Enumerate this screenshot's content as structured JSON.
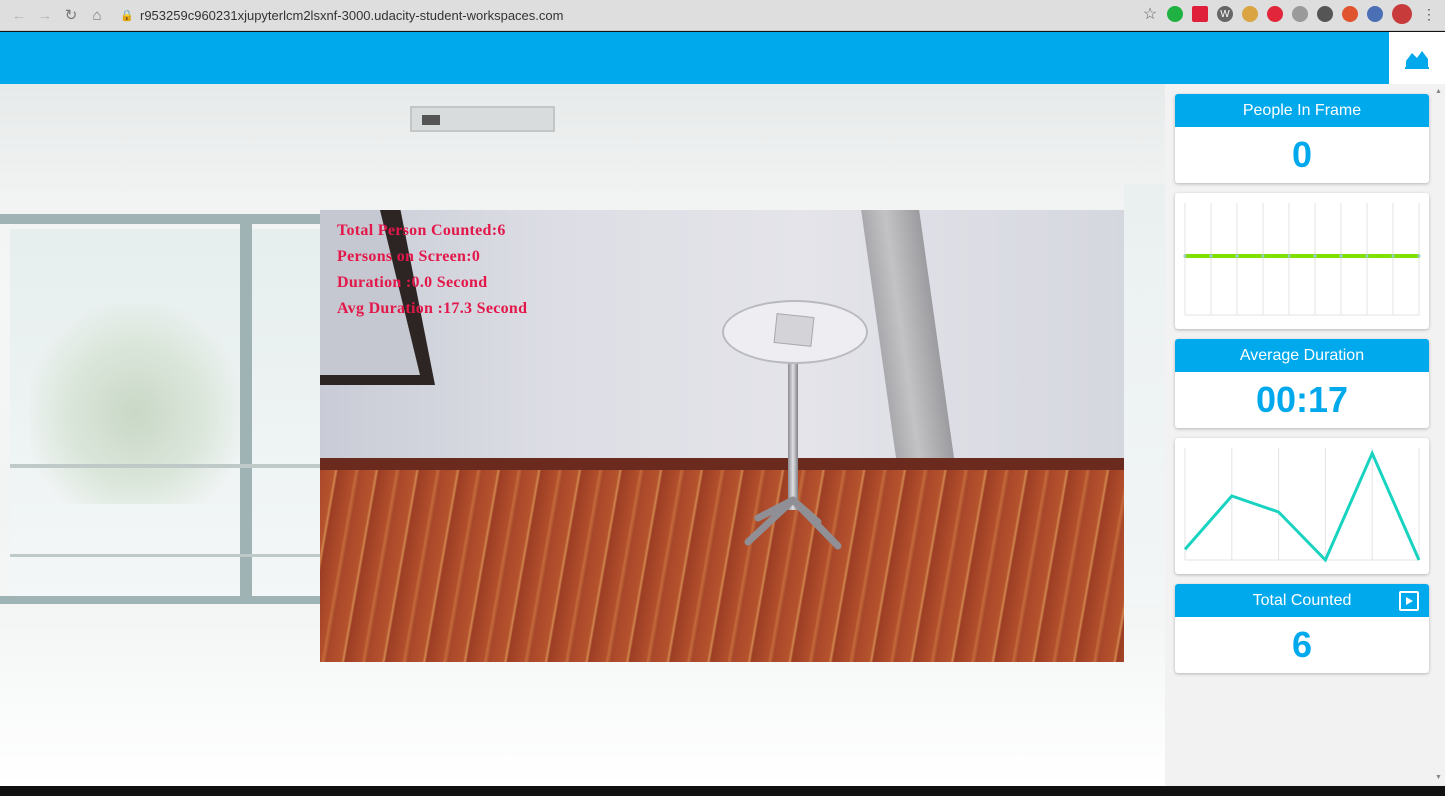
{
  "browser": {
    "url": "r953259c960231xjupyterlcm2lsxnf-3000.udacity-student-workspaces.com",
    "nav_icons": [
      "back-icon",
      "forward-icon",
      "reload-icon",
      "home-icon"
    ]
  },
  "header": {
    "toggle_icon": "area-chart-icon"
  },
  "video": {
    "overlay_lines": [
      "Total Person Counted:6",
      "Persons on Screen:0",
      "Duration :0.0 Second",
      "Avg Duration :17.3 Second"
    ]
  },
  "stats": {
    "people_in_frame": {
      "title": "People In Frame",
      "value": "0"
    },
    "average_duration": {
      "title": "Average Duration",
      "value": "00:17"
    },
    "total_counted": {
      "title": "Total Counted",
      "value": "6"
    }
  },
  "colors": {
    "accent": "#00a8ec",
    "overlay_text": "#e3174a",
    "people_line": "#7ee000",
    "duration_line": "#17d3c0"
  },
  "chart_data": [
    {
      "type": "line",
      "x": [
        0,
        1,
        2,
        3,
        4,
        5,
        6,
        7,
        8,
        9
      ],
      "values": [
        0,
        0,
        0,
        0,
        0,
        0,
        0,
        0,
        0,
        0
      ],
      "ylim": [
        0,
        1
      ],
      "grid": true
    },
    {
      "type": "line",
      "x": [
        0,
        1,
        2,
        3,
        4,
        5
      ],
      "values": [
        2,
        12,
        9,
        0,
        20,
        0
      ],
      "ylim": [
        0,
        21
      ],
      "grid": true
    }
  ]
}
